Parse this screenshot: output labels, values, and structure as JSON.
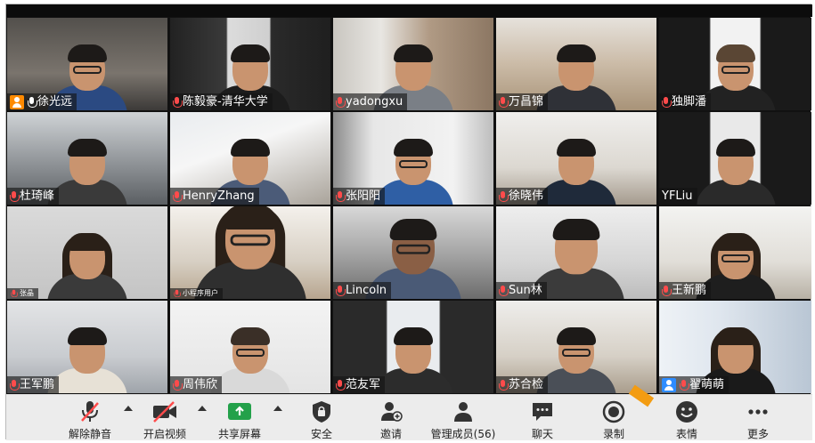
{
  "participants": [
    {
      "name": "徐光远",
      "host": true,
      "host_color": "#ff8a00",
      "mic": "on"
    },
    {
      "name": "陈毅豪-清华大学",
      "mic": "muted"
    },
    {
      "name": "yadongxu",
      "mic": "muted"
    },
    {
      "name": "万昌锦",
      "mic": "muted"
    },
    {
      "name": "独脚潘",
      "mic": "muted"
    },
    {
      "name": "杜琦峰",
      "mic": "muted"
    },
    {
      "name": "HenryZhang",
      "mic": "muted"
    },
    {
      "name": "张阳阳",
      "mic": "muted"
    },
    {
      "name": "徐晓伟",
      "mic": "muted"
    },
    {
      "name": "YFLiu",
      "mic": "none"
    },
    {
      "name": "张晶",
      "mic": "muted",
      "small": true
    },
    {
      "name": "小程序用户",
      "mic": "muted",
      "small": true
    },
    {
      "name": "Lincoln",
      "mic": "muted"
    },
    {
      "name": "Sun林",
      "mic": "muted"
    },
    {
      "name": "王新鹏",
      "mic": "muted"
    },
    {
      "name": "王军鹏",
      "mic": "muted"
    },
    {
      "name": "周伟欣",
      "mic": "muted"
    },
    {
      "name": "范友军",
      "mic": "muted"
    },
    {
      "name": "苏合检",
      "mic": "muted"
    },
    {
      "name": "翟萌萌",
      "host": true,
      "host_color": "#2d8cff",
      "mic": "muted"
    }
  ],
  "toolbar": {
    "unmute": "解除静音",
    "start_video": "开启视频",
    "share_screen": "共享屏幕",
    "security": "安全",
    "invite": "邀请",
    "manage_participants": "管理成员(56)",
    "chat": "聊天",
    "record": "录制",
    "reactions": "表情",
    "more": "更多"
  },
  "colors": {
    "muted_red": "#ff4b4b",
    "share_green": "#23a14a",
    "toolbar_bg": "#ececec",
    "host_orange": "#ff8a00"
  }
}
